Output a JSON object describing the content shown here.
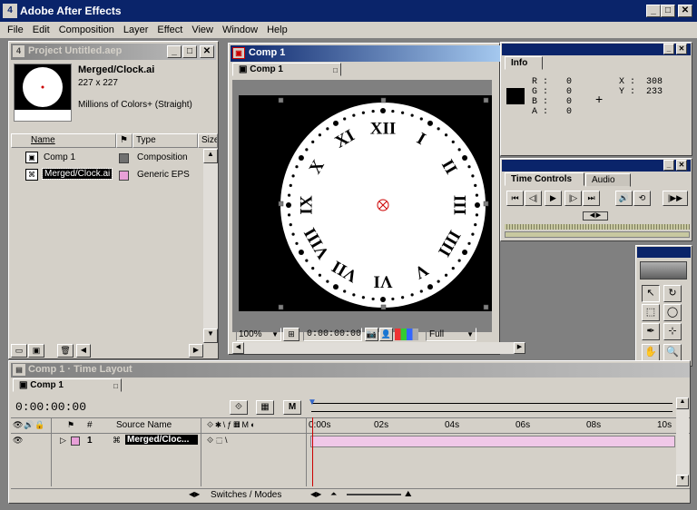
{
  "app": {
    "title": "Adobe After Effects",
    "icon": "ae-icon"
  },
  "menu": [
    "File",
    "Edit",
    "Composition",
    "Layer",
    "Effect",
    "View",
    "Window",
    "Help"
  ],
  "project": {
    "title": "Project Untitled.aep",
    "selected_name": "Merged/Clock.ai",
    "selected_size": "227 x 227",
    "selected_color": "Millions of Colors+ (Straight)",
    "columns": {
      "name": "Name",
      "type": "Type",
      "size": "Size"
    },
    "items": [
      {
        "name": "Comp 1",
        "type": "Composition",
        "swatch": "#707070"
      },
      {
        "name": "Merged/Clock.ai",
        "type": "Generic EPS",
        "swatch": "#e8a0d8"
      }
    ]
  },
  "comp": {
    "title": "Comp 1",
    "tab": "Comp 1",
    "zoom": "100%",
    "timecode": "0:00:00:00",
    "resolution": "Full",
    "numerals": [
      "XII",
      "I",
      "II",
      "III",
      "IIII",
      "V",
      "VI",
      "VII",
      "VIII",
      "IX",
      "X",
      "XI"
    ]
  },
  "info": {
    "tab": "Info",
    "r_label": "R :",
    "r": "0",
    "g_label": "G :",
    "g": "0",
    "b_label": "B :",
    "b": "0",
    "a_label": "A :",
    "a": "0",
    "x_label": "X :",
    "x": "308",
    "y_label": "Y :",
    "y": "233"
  },
  "time_controls": {
    "tab": "Time Controls",
    "tab2": "Audio"
  },
  "timeline": {
    "title": "Comp 1 · Time Layout",
    "tab": "Comp 1",
    "timecode": "0:00:00:00",
    "col_hash": "#",
    "col_source": "Source Name",
    "ruler": [
      "0:00s",
      "02s",
      "04s",
      "06s",
      "08s",
      "10s"
    ],
    "layer_num": "1",
    "layer_name": "Merged/Cloc...",
    "switches_modes": "Switches / Modes"
  }
}
